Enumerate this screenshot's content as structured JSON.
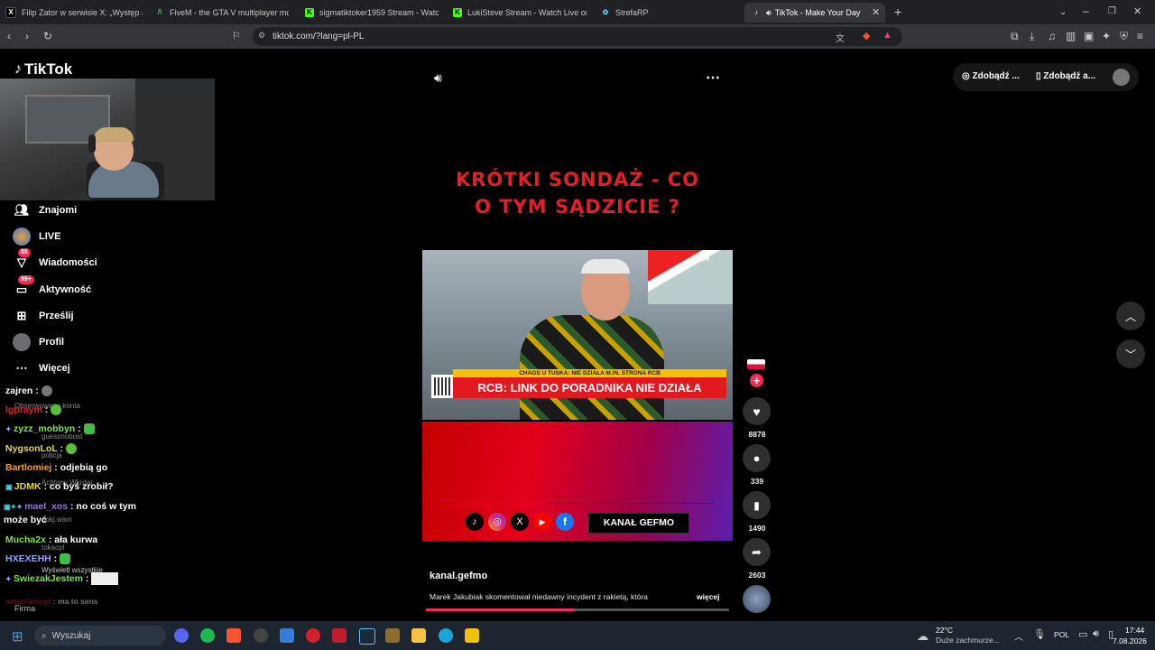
{
  "browser": {
    "tabs": [
      {
        "label": "Filip Zator w serwisie X: „Występ arty"
      },
      {
        "label": "FiveM - the GTA V multiplayer modifi"
      },
      {
        "label": "sigmatiktoker1959 Stream - Watch Li"
      },
      {
        "label": "LukiSteve Stream - Watch Live on Kic"
      },
      {
        "label": "StrefaRP"
      },
      {
        "label": "TikTok - Make Your Day"
      }
    ],
    "url": "tiktok.com/?lang=pl-PL"
  },
  "sidebar": {
    "logo": "TikTok",
    "items": [
      {
        "label": "Znajomi",
        "icon": "friends-icon"
      },
      {
        "label": "LIVE",
        "icon": "live-icon"
      },
      {
        "label": "Wiadomości",
        "icon": "messages-icon",
        "badge": "88"
      },
      {
        "label": "Aktywność",
        "icon": "activity-icon",
        "badge": "99+"
      },
      {
        "label": "Prześlij",
        "icon": "upload-icon"
      },
      {
        "label": "Profil",
        "icon": "profile-icon"
      },
      {
        "label": "Więcej",
        "icon": "more-icon"
      }
    ],
    "ghost_texts": [
      "Obserwowane konta",
      "guessnobost",
      "policja",
      "Achtony Wkrdar",
      "pokj.wam",
      "tokacpl",
      "Wyświetl wszystkie",
      "Firma"
    ]
  },
  "chat": [
    {
      "user": "zajren",
      "text": "",
      "color": "#ffffff"
    },
    {
      "user": "lgpraym",
      "text": "",
      "color": "#d42a2a"
    },
    {
      "user": "zyzz_mobbyn",
      "text": "",
      "color": "#7ee24a"
    },
    {
      "user": "NygsonLoL",
      "text": "",
      "color": "#e5d846"
    },
    {
      "user": "Bartlomiej",
      "text": "odjebią go",
      "color": "#f0a040"
    },
    {
      "user": "JDMK",
      "text": "co byś zrobił?",
      "color": "#e5d846"
    },
    {
      "user": "mael_xos",
      "text": "no coś w tym może być",
      "color": "#9b6ee8"
    },
    {
      "user": "Mucha2x",
      "text": "ała kurwa",
      "color": "#7ee24a"
    },
    {
      "user": "HXEXEHH",
      "text": "",
      "color": "#8fa8ff"
    },
    {
      "user": "SwiezakJestem",
      "text": "",
      "color": "#7ee24a"
    },
    {
      "user": "antsolinhopl",
      "text": "ma to sens",
      "color": "#d42a2a"
    }
  ],
  "video": {
    "title_line1": "KRÓTKI SONDAŻ - CO",
    "title_line2": "O TYM SĄDZICIE ?",
    "ticker_top": "CHAOS U TUSKA: NIE DZIAŁA M.IN. STRONA RCB",
    "ticker_main": "RCB: LINK DO PORADNIKA NIE DZIAŁA",
    "channel_badge": "24",
    "promo_label": "KANAŁ GEFMO",
    "author": "kanal.gefmo",
    "description": "Marek Jakubiak skomentował niedawny incydent z rakietą, która",
    "more": "więcej",
    "progress": 0.49
  },
  "actions": {
    "likes": "8878",
    "comments": "339",
    "saves": "1490",
    "shares": "2603"
  },
  "header": {
    "get_coins": "Zdobądź ...",
    "get_app": "Zdobądź a..."
  },
  "taskbar": {
    "search": "Wyszukaj",
    "weather_temp": "22°C",
    "weather_desc": "Duże zachmurze...",
    "lang": "POL",
    "time": "17:44",
    "date": "7.08.2026"
  },
  "colors": {
    "tiktok_red": "#fe2c55",
    "title_red": "#e0202c"
  }
}
